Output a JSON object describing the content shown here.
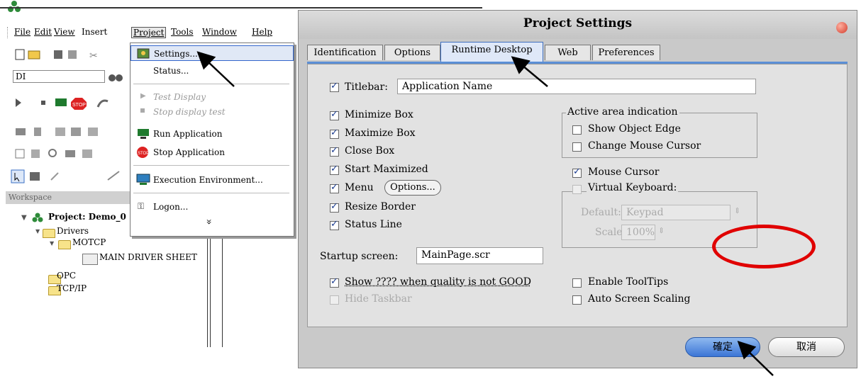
{
  "ide": {
    "menu": [
      {
        "label": "File"
      },
      {
        "label": "Edit"
      },
      {
        "label": "View"
      },
      {
        "label": "Insert"
      },
      {
        "label": "Project"
      },
      {
        "label": "Tools"
      },
      {
        "label": "Window"
      },
      {
        "label": "Help"
      }
    ],
    "filter_value": "DI",
    "dropdown": {
      "settings": "Settings...",
      "status": "Status...",
      "test_display": "Test Display",
      "stop_display": "Stop display test",
      "run": "Run Application",
      "stop": "Stop Application",
      "exec_env": "Execution Environment...",
      "logon": "Logon...",
      "more": "»"
    },
    "workspace": {
      "header": "Workspace",
      "project": "Project: Demo_0",
      "drivers": "Drivers",
      "motcp": "MOTCP",
      "main_sheet": "MAIN DRIVER SHEET",
      "opc": "OPC",
      "tcpip": "TCP/IP"
    }
  },
  "dialog": {
    "title": "Project Settings",
    "tabs": [
      "Identification",
      "Options",
      "Runtime Desktop",
      "Web",
      "Preferences"
    ],
    "active_tab": "Runtime Desktop",
    "titlebar_label": "Titlebar:",
    "titlebar_value": "Application Name",
    "checks": {
      "minimize": "Minimize Box",
      "maximize": "Maximize Box",
      "close": "Close Box",
      "start_max": "Start Maximized",
      "menu": "Menu",
      "resize": "Resize Border",
      "status": "Status Line"
    },
    "options_button": "Options...",
    "active_area": {
      "title": "Active area indication",
      "show_edge": "Show Object Edge",
      "change_cursor": "Change Mouse Cursor"
    },
    "mouse_cursor": "Mouse Cursor",
    "virtual_keyboard": {
      "title": "Virtual Keyboard:",
      "default_label": "Default:",
      "default_value": "Keypad",
      "scale_label": "Scale",
      "scale_value": "100%"
    },
    "startup_label": "Startup screen:",
    "startup_value": "MainPage.scr",
    "show_quality": "Show ???? when quality is not GOOD",
    "hide_taskbar": "Hide Taskbar",
    "enable_tooltips": "Enable ToolTips",
    "auto_scaling": "Auto Screen Scaling",
    "ok": "確定",
    "cancel": "取消"
  },
  "colors": {
    "highlight": "#e00000",
    "accent": "#3b75d6"
  }
}
